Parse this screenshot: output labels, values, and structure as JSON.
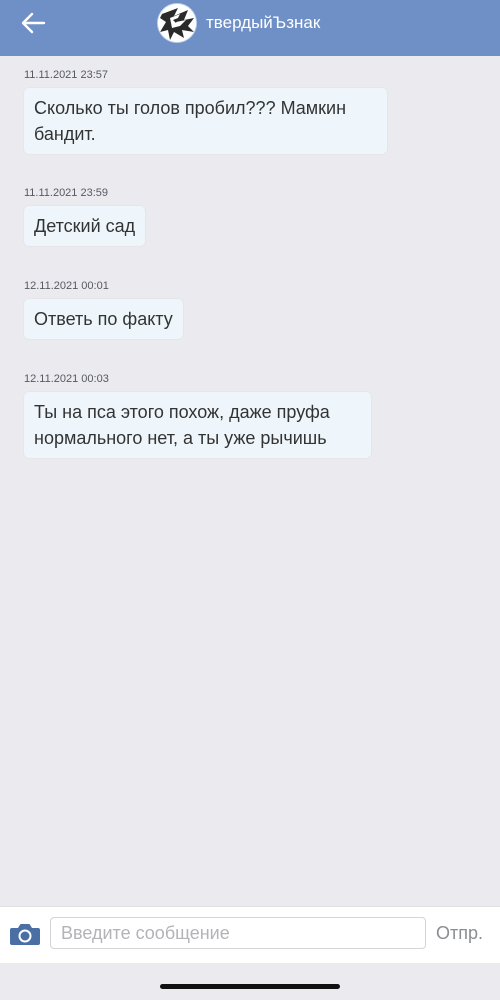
{
  "header": {
    "contact_name": "твердыйЪзнак",
    "back_icon": "arrow-left-icon",
    "background_color": "#6f8fc7"
  },
  "messages": [
    {
      "timestamp": "11.11.2021 23:57",
      "text": "Сколько ты голов пробил??? Мамкин бандит."
    },
    {
      "timestamp": "11.11.2021 23:59",
      "text": "Детский сад"
    },
    {
      "timestamp": "12.11.2021 00:01",
      "text": "Ответь по факту"
    },
    {
      "timestamp": "12.11.2021 00:03",
      "text": "Ты на пса этого похож, даже пруфа нормального нет, а ты уже рычишь"
    }
  ],
  "composer": {
    "placeholder": "Введите сообщение",
    "value": "",
    "send_label": "Отпр.",
    "camera_icon": "camera-icon",
    "accent_color": "#4a6fa5"
  }
}
